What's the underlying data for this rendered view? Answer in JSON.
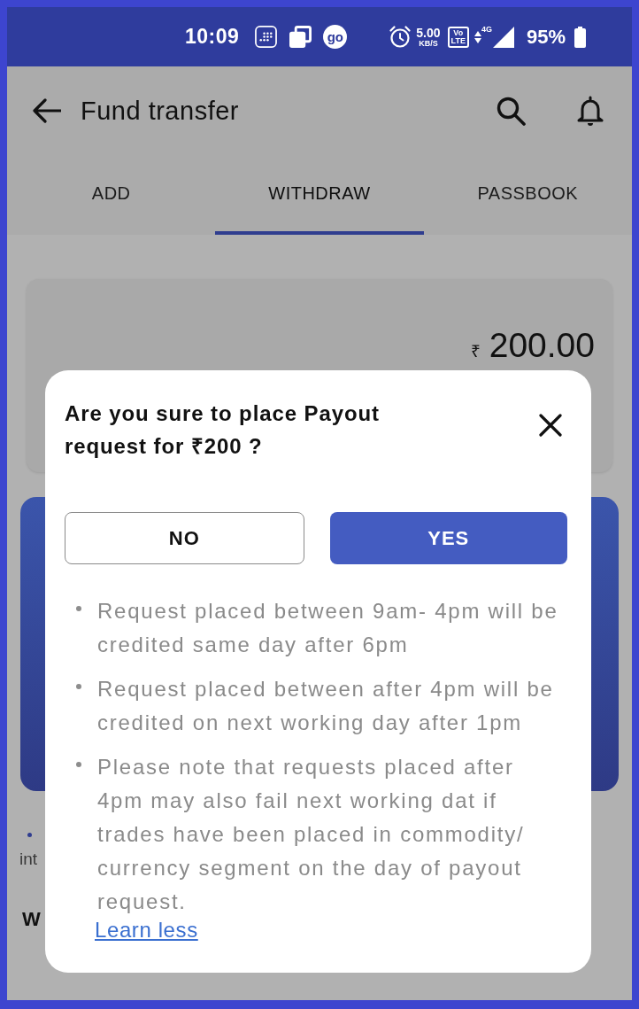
{
  "status_bar": {
    "time": "10:09",
    "app_badge": "go",
    "speed": "5.00",
    "speed_unit": "KB/S",
    "volte": [
      "Vo",
      "LTE"
    ],
    "network": "4G",
    "battery": "95%"
  },
  "header": {
    "title": "Fund transfer"
  },
  "tabs": [
    {
      "label": "ADD",
      "selected": false
    },
    {
      "label": "WITHDRAW",
      "selected": true
    },
    {
      "label": "PASSBOOK",
      "selected": false
    }
  ],
  "amount_card": {
    "currency": "₹",
    "amount": "200.00"
  },
  "background_note": "int",
  "background_heading": "W",
  "dialog": {
    "title": "Are you sure to place Payout request for ₹200 ?",
    "buttons": [
      {
        "label": "NO",
        "kind": "outline"
      },
      {
        "label": "YES",
        "kind": "primary"
      }
    ],
    "notes": [
      "Request placed between 9am- 4pm will be credited same day after 6pm",
      "Request placed between after 4pm will be credited on next working day after 1pm",
      "Please note that requests placed after 4pm may also fail next working dat if trades have been placed in commodity/ currency segment on the day of payout request."
    ],
    "link": "Learn less"
  }
}
